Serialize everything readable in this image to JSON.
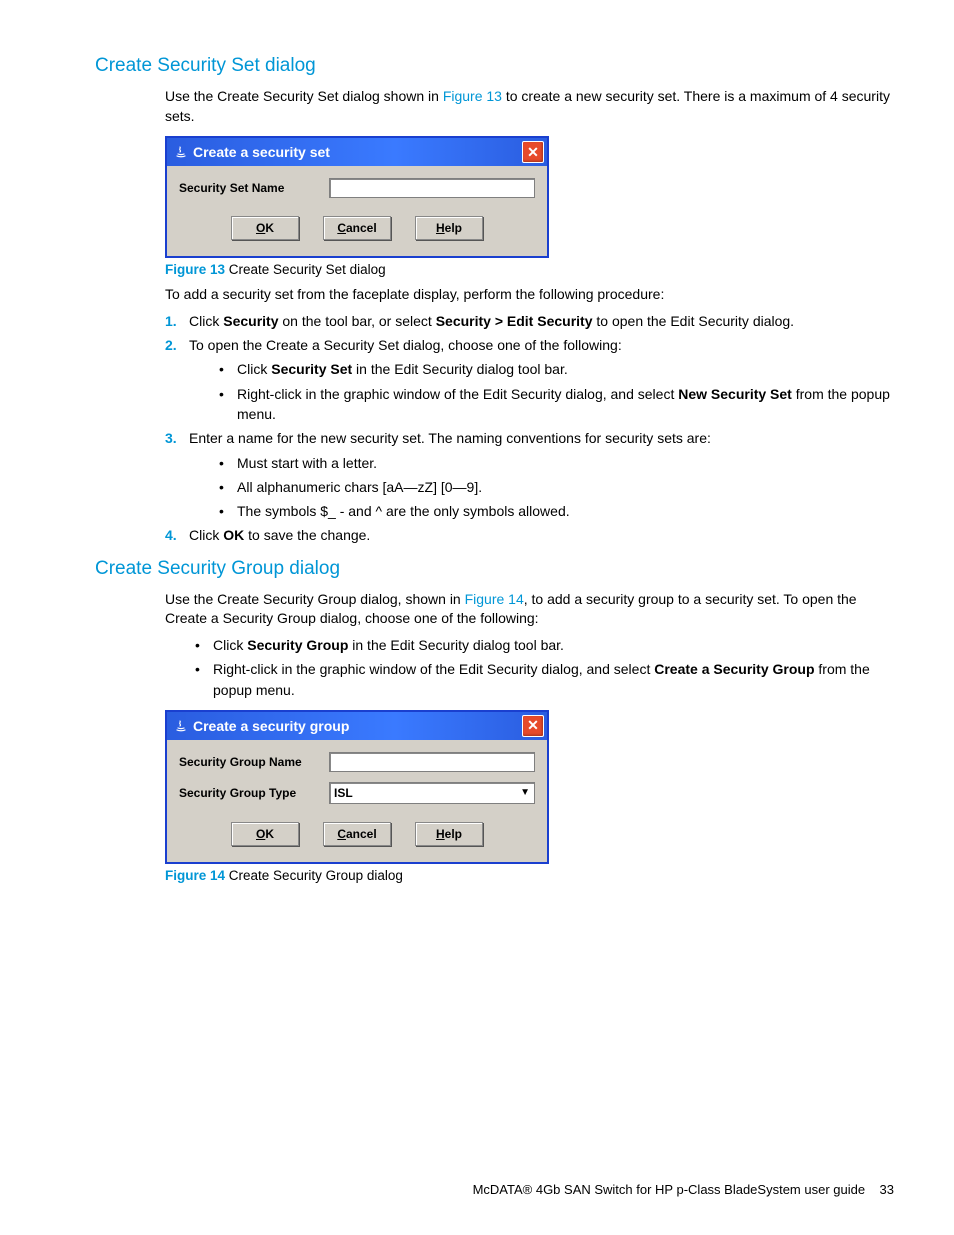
{
  "section1": {
    "heading": "Create Security Set dialog",
    "intro_a": "Use the Create Security Set dialog shown in ",
    "intro_ref": "Figure 13",
    "intro_b": " to create a new security set. There is a maximum of 4 security sets.",
    "dialog": {
      "title": "Create a security set",
      "label": "Security Set Name",
      "ok": "OK",
      "cancel": "Cancel",
      "help": "Help"
    },
    "caption_label": "Figure 13",
    "caption_text": " Create Security Set dialog",
    "lead": "To add a security set from the faceplate display, perform the following procedure:",
    "s1a": "Click ",
    "s1b": "Security",
    "s1c": " on the tool bar, or select ",
    "s1d": "Security > Edit Security",
    "s1e": " to open the Edit Security dialog.",
    "s2": "To open the Create a Security Set dialog, choose one of the following:",
    "s2_b1a": "Click ",
    "s2_b1b": "Security Set",
    "s2_b1c": " in the Edit Security dialog tool bar.",
    "s2_b2a": "Right-click in the graphic window of the Edit Security dialog, and select ",
    "s2_b2b": "New Security Set",
    "s2_b2c": " from the popup menu.",
    "s3": "Enter a name for the new security set. The naming conventions for security sets are:",
    "s3_b1": "Must start with a letter.",
    "s3_b2": "All alphanumeric chars [aA—zZ] [0—9].",
    "s3_b3": "The symbols $_ - and ^ are the only symbols allowed.",
    "s4a": "Click ",
    "s4b": "OK",
    "s4c": " to save the change."
  },
  "section2": {
    "heading": "Create Security Group dialog",
    "intro_a": "Use the Create Security Group dialog, shown in ",
    "intro_ref": "Figure 14",
    "intro_b": ", to add a security group to a security set. To open the Create a Security Group dialog, choose one of the following:",
    "b1a": "Click ",
    "b1b": "Security Group",
    "b1c": " in the Edit Security dialog tool bar.",
    "b2a": "Right-click in the graphic window of the Edit Security dialog, and select ",
    "b2b": "Create a Security Group",
    "b2c": " from the popup menu.",
    "dialog": {
      "title": "Create a security group",
      "label_name": "Security Group Name",
      "label_type": "Security Group Type",
      "type_value": "ISL",
      "ok": "OK",
      "cancel": "Cancel",
      "help": "Help"
    },
    "caption_label": "Figure 14",
    "caption_text": " Create Security Group dialog"
  },
  "footer": {
    "text": "McDATA® 4Gb SAN Switch for HP p-Class BladeSystem user guide",
    "page": "33"
  }
}
